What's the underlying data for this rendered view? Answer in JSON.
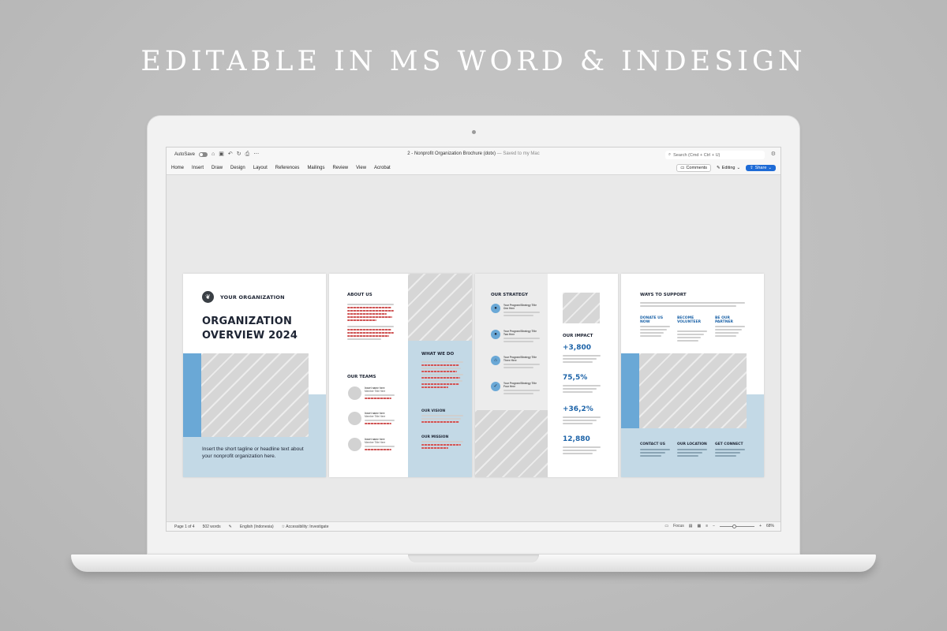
{
  "headline": "EDITABLE IN MS WORD & INDESIGN",
  "word": {
    "autosave_label": "AutoSave",
    "doc_title": "2 - Nonprofit Organization Brochure (dotx)",
    "saved_state": "— Saved to my Mac",
    "search_placeholder": "Search (Cmd + Ctrl + U)",
    "ribbon_tabs": [
      "Home",
      "Insert",
      "Draw",
      "Design",
      "Layout",
      "References",
      "Mailings",
      "Review",
      "View",
      "Acrobat"
    ],
    "comments_label": "Comments",
    "editing_label": "Editing",
    "share_label": "Share",
    "status": {
      "page": "Page 1 of 4",
      "words": "502 words",
      "language": "English (Indonesia)",
      "accessibility": "Accessibility: Investigate",
      "focus": "Focus",
      "zoom": "68%"
    }
  },
  "brochure": {
    "cover": {
      "org_name": "YOUR ORGANIZATION",
      "title_line1": "ORGANIZATION",
      "title_line2": "OVERVIEW 2024",
      "tagline": "Insert the short tagline or headline text about your nonprofit organization here."
    },
    "about": {
      "about_heading": "ABOUT US",
      "teams_heading": "OUR TEAMS",
      "team_members": [
        {
          "name": "Insert name here",
          "title": "Member Title Here"
        },
        {
          "name": "Insert name here",
          "title": "Member Title Here"
        },
        {
          "name": "Insert name here",
          "title": "Member Title Here"
        }
      ],
      "what_we_do_heading": "WHAT WE DO",
      "vision_heading": "OUR VISION",
      "mission_heading": "OUR MISSION"
    },
    "strategy": {
      "heading": "OUR STRATEGY",
      "items": [
        {
          "title": "Your Program/Strategy Title One Here",
          "icon": "person-icon"
        },
        {
          "title": "Your Program/Strategy Title Two Here",
          "icon": "people-icon"
        },
        {
          "title": "Your Program/Strategy Title Three Here",
          "icon": "home-icon"
        },
        {
          "title": "Your Program/Strategy Title Four Here",
          "icon": "check-icon"
        }
      ],
      "impact_heading": "OUR IMPACT",
      "stats": [
        "+3,800",
        "75,5%",
        "+36,2%",
        "12,880"
      ]
    },
    "support": {
      "heading": "WAYS TO SUPPORT",
      "columns": [
        "DONATE US NOW",
        "BECOME VOLUNTEER",
        "BE OUR PARTNER"
      ],
      "footer": [
        "CONTACT US",
        "OUR LOCATION",
        "GET CONNECT"
      ]
    }
  },
  "colors": {
    "accent_blue": "#6aa8d6",
    "light_blue": "#c3d9e6",
    "navy": "#1d2433",
    "share_blue": "#1e6bd6"
  }
}
